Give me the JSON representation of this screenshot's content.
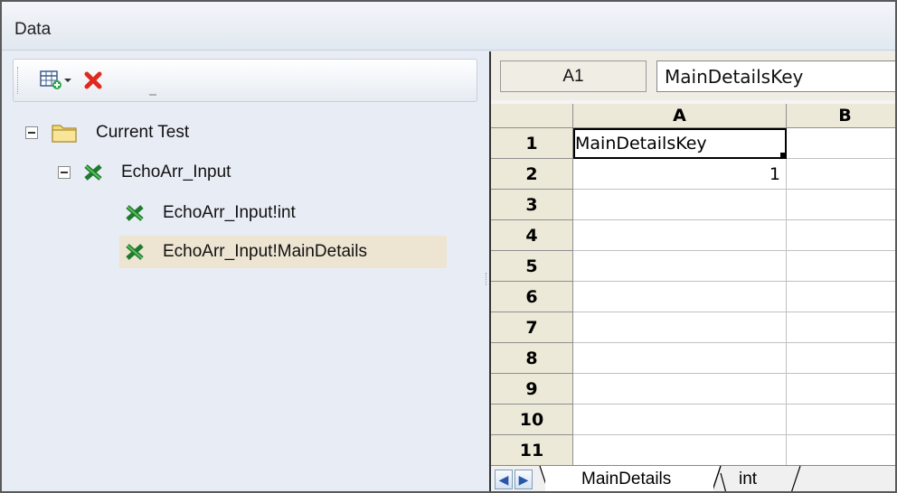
{
  "panel_title": "Data",
  "toolbar": {
    "add_icon": "table-add-icon",
    "dropdown_icon": "chevron-down-icon",
    "delete_icon": "delete-icon",
    "more_icon": "overflow-icon"
  },
  "tree": {
    "items": [
      {
        "label": "Current Test",
        "icon": "folder-icon",
        "expanded": true,
        "level": 0
      },
      {
        "label": "EchoArr_Input",
        "icon": "excel-icon",
        "expanded": true,
        "level": 1
      },
      {
        "label": "EchoArr_Input!int",
        "icon": "excel-icon",
        "level": 2
      },
      {
        "label": "EchoArr_Input!MainDetails",
        "icon": "excel-icon",
        "level": 2,
        "selected": true
      }
    ]
  },
  "spreadsheet": {
    "name_box": "A1",
    "formula_value": "MainDetailsKey",
    "columns": [
      "A",
      "B"
    ],
    "rows": [
      "1",
      "2",
      "3",
      "4",
      "5",
      "6",
      "7",
      "8",
      "9",
      "10",
      "11"
    ],
    "cells": {
      "A1": "MainDetailsKey",
      "A2": "1"
    },
    "sheet_tabs": [
      "MainDetails",
      "int"
    ],
    "active_tab": "MainDetails"
  },
  "colors": {
    "panel_bg": "#e8edf5",
    "header_bg": "#ece9d8",
    "selection_bg": "#ede4d2",
    "excel_green": "#1e7a2e",
    "delete_red": "#e02a1f"
  }
}
